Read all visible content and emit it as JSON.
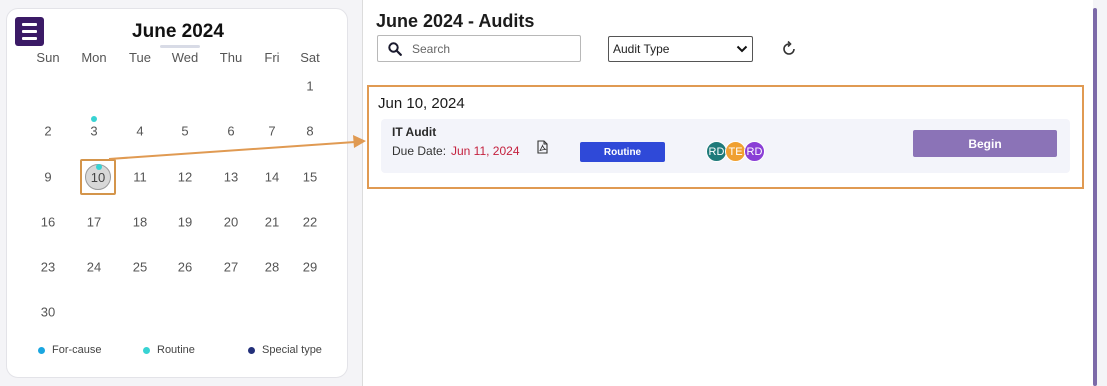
{
  "calendar": {
    "title": "June 2024",
    "weekdays": [
      "Sun",
      "Mon",
      "Tue",
      "Wed",
      "Thu",
      "Fri",
      "Sat"
    ],
    "days": [
      "1",
      "2",
      "3",
      "4",
      "5",
      "6",
      "7",
      "8",
      "9",
      "10",
      "11",
      "12",
      "13",
      "14",
      "15",
      "16",
      "17",
      "18",
      "19",
      "20",
      "21",
      "22",
      "23",
      "24",
      "25",
      "26",
      "27",
      "28",
      "29",
      "30"
    ],
    "selected_day": "10",
    "routine_marked_days": [
      "3",
      "10"
    ],
    "legend": [
      {
        "label": "For-cause",
        "color": "#1aa6e0"
      },
      {
        "label": "Routine",
        "color": "#38d3d3"
      },
      {
        "label": "Special type",
        "color": "#23307a"
      }
    ]
  },
  "main": {
    "title": "June 2024 - Audits",
    "search": {
      "placeholder": "Search",
      "value": ""
    },
    "filter": {
      "selected": "Audit Type"
    },
    "groups": [
      {
        "date": "Jun 10, 2024",
        "audits": [
          {
            "name": "IT Audit",
            "due_label": "Due Date:",
            "due_value": "Jun 11, 2024",
            "type": "Routine",
            "assignees": [
              {
                "initials": "RD",
                "color": "#1f7a7a"
              },
              {
                "initials": "TE",
                "color": "#f0a030"
              },
              {
                "initials": "RD",
                "color": "#8a3fd6"
              }
            ],
            "action": "Begin"
          }
        ]
      }
    ]
  },
  "icons": {
    "menu": "hamburger-menu-icon",
    "search": "search-icon",
    "refresh": "refresh-icon",
    "pdf": "pdf-file-icon",
    "dropdown": "chevron-down-icon"
  },
  "colors": {
    "brand": "#3b1a66",
    "accent_button": "#8b73b7",
    "badge_routine": "#2f49d8",
    "due_date": "#c4213e",
    "highlight_annotation": "#e09a52"
  }
}
